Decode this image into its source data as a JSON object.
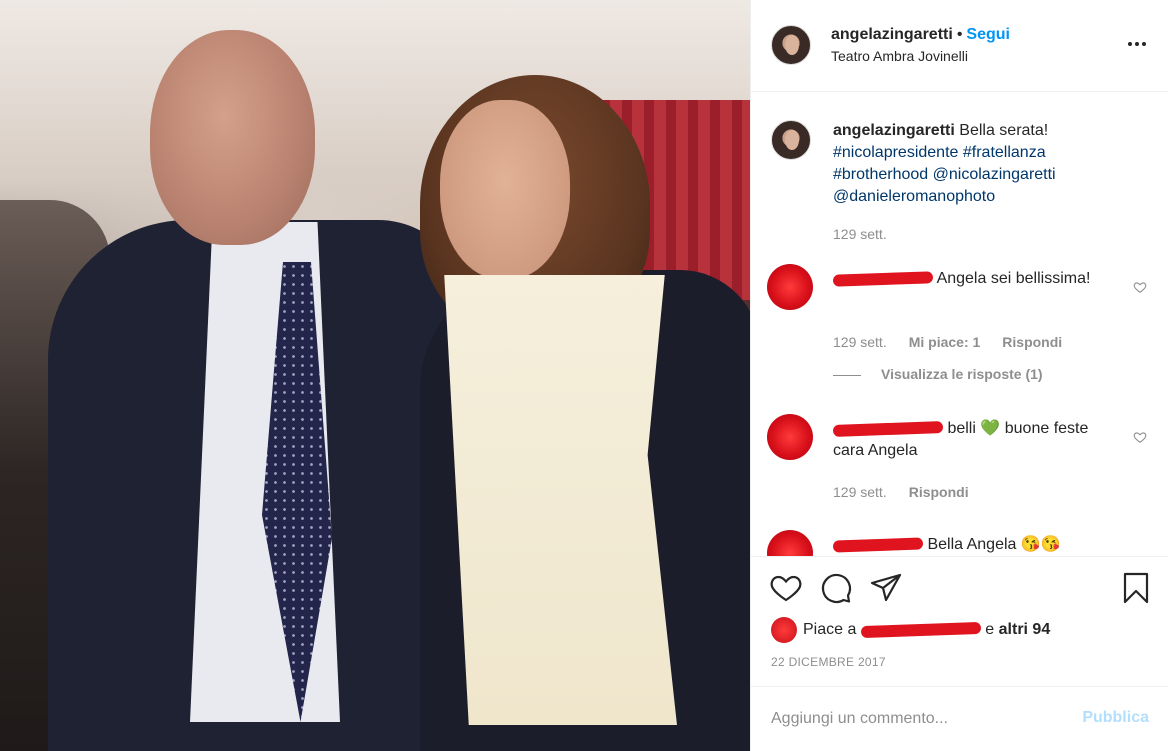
{
  "header": {
    "username": "angelazingaretti",
    "separator": "•",
    "follow_label": "Segui",
    "location": "Teatro Ambra Jovinelli"
  },
  "caption": {
    "username": "angelazingaretti",
    "text": "Bella serata!",
    "tags": [
      "#nicolapresidente",
      "#fratellanza",
      "#brotherhood",
      "@nicolazingaretti",
      "@danieleromanophoto"
    ],
    "time": "129 sett."
  },
  "comments": [
    {
      "text": "Angela sei bellissima!",
      "time": "129 sett.",
      "likes_label": "Mi piace: 1",
      "reply_label": "Rispondi",
      "view_replies": "Visualizza le risposte (1)"
    },
    {
      "text_before_emoji": "belli",
      "emoji": "💚",
      "text_after_emoji": "buone feste cara Angela",
      "time": "129 sett.",
      "reply_label": "Rispondi"
    },
    {
      "text": "Bella Angela",
      "emoji": "😘😘"
    }
  ],
  "likes": {
    "prefix": "Piace a",
    "suffix_plain": "e",
    "suffix_bold": "altri 94"
  },
  "date": "22 DICEMBRE 2017",
  "add_comment": {
    "placeholder": "Aggiungi un commento...",
    "publish_label": "Pubblica"
  },
  "icons": {
    "more": "more-icon",
    "like": "heart-icon",
    "comment": "comment-icon",
    "share": "share-icon",
    "save": "bookmark-icon"
  },
  "colors": {
    "link_blue": "#0095f6",
    "tag_blue": "#00376b",
    "muted": "#8e8e8e",
    "redaction": "#e0141f"
  }
}
